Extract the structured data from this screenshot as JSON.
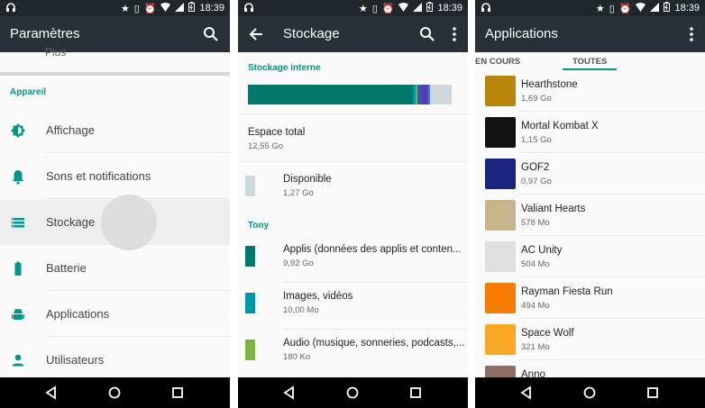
{
  "status_bar": {
    "time": "18:39"
  },
  "settings": {
    "title": "Paramètres",
    "partial_item": "Plus",
    "section": "Appareil",
    "items": [
      {
        "label": "Affichage"
      },
      {
        "label": "Sons et notifications"
      },
      {
        "label": "Stockage"
      },
      {
        "label": "Batterie"
      },
      {
        "label": "Applications"
      },
      {
        "label": "Utilisateurs"
      }
    ]
  },
  "storage": {
    "title": "Stockage",
    "internal_header": "Stockage interne",
    "bar_segments": [
      {
        "name": "Applis",
        "fraction": 0.79,
        "color": "#00796b"
      },
      {
        "name": "Images",
        "fraction": 0.012,
        "color": "#0097a7"
      },
      {
        "name": "Audio",
        "fraction": 0.01,
        "color": "#7cb342"
      },
      {
        "name": "Other1",
        "fraction": 0.025,
        "color": "#3f51b5"
      },
      {
        "name": "Other2",
        "fraction": 0.015,
        "color": "#5e35b1"
      },
      {
        "name": "Other3",
        "fraction": 0.01,
        "color": "#673ab7"
      },
      {
        "name": "Other4",
        "fraction": 0.01,
        "color": "#1e88e5"
      },
      {
        "name": "Libre",
        "fraction": 0.101,
        "color": "#cfd8dc"
      }
    ],
    "total": {
      "label": "Espace total",
      "value": "12,55 Go"
    },
    "available": {
      "label": "Disponible",
      "value": "1,27 Go",
      "color": "#cfd8dc"
    },
    "user_header": "Tony",
    "categories": [
      {
        "label": "Applis (données des applis et conten...",
        "value": "9,92 Go",
        "color": "#00796b"
      },
      {
        "label": "Images, vidéos",
        "value": "10,00 Mo",
        "color": "#0097a7"
      },
      {
        "label": "Audio (musique, sonneries, podcasts,...",
        "value": "180 Ko",
        "color": "#7cb342"
      }
    ]
  },
  "applications": {
    "title": "Applications",
    "tabs": [
      {
        "label": "EN COURS",
        "active": false
      },
      {
        "label": "TOUTES",
        "active": true
      }
    ],
    "apps": [
      {
        "name": "Hearthstone",
        "size": "1,69 Go",
        "icon": "hearthstone-icon",
        "color": "#b8860b"
      },
      {
        "name": "Mortal Kombat X",
        "size": "1,15 Go",
        "icon": "mortal-kombat-icon",
        "color": "#111111"
      },
      {
        "name": "GOF2",
        "size": "0,97 Go",
        "icon": "gof2-icon",
        "color": "#1a237e"
      },
      {
        "name": "Valiant Hearts",
        "size": "578 Mo",
        "icon": "valiant-hearts-icon",
        "color": "#c8b48a"
      },
      {
        "name": "AC Unity",
        "size": "504 Mo",
        "icon": "ac-unity-icon",
        "color": "#e0e0e0"
      },
      {
        "name": "Rayman Fiesta Run",
        "size": "494 Mo",
        "icon": "rayman-icon",
        "color": "#f57c00"
      },
      {
        "name": "Space Wolf",
        "size": "321 Mo",
        "icon": "space-wolf-icon",
        "color": "#f9a825"
      },
      {
        "name": "Anno",
        "size": "",
        "icon": "anno-icon",
        "color": "#8d6e63"
      }
    ]
  }
}
